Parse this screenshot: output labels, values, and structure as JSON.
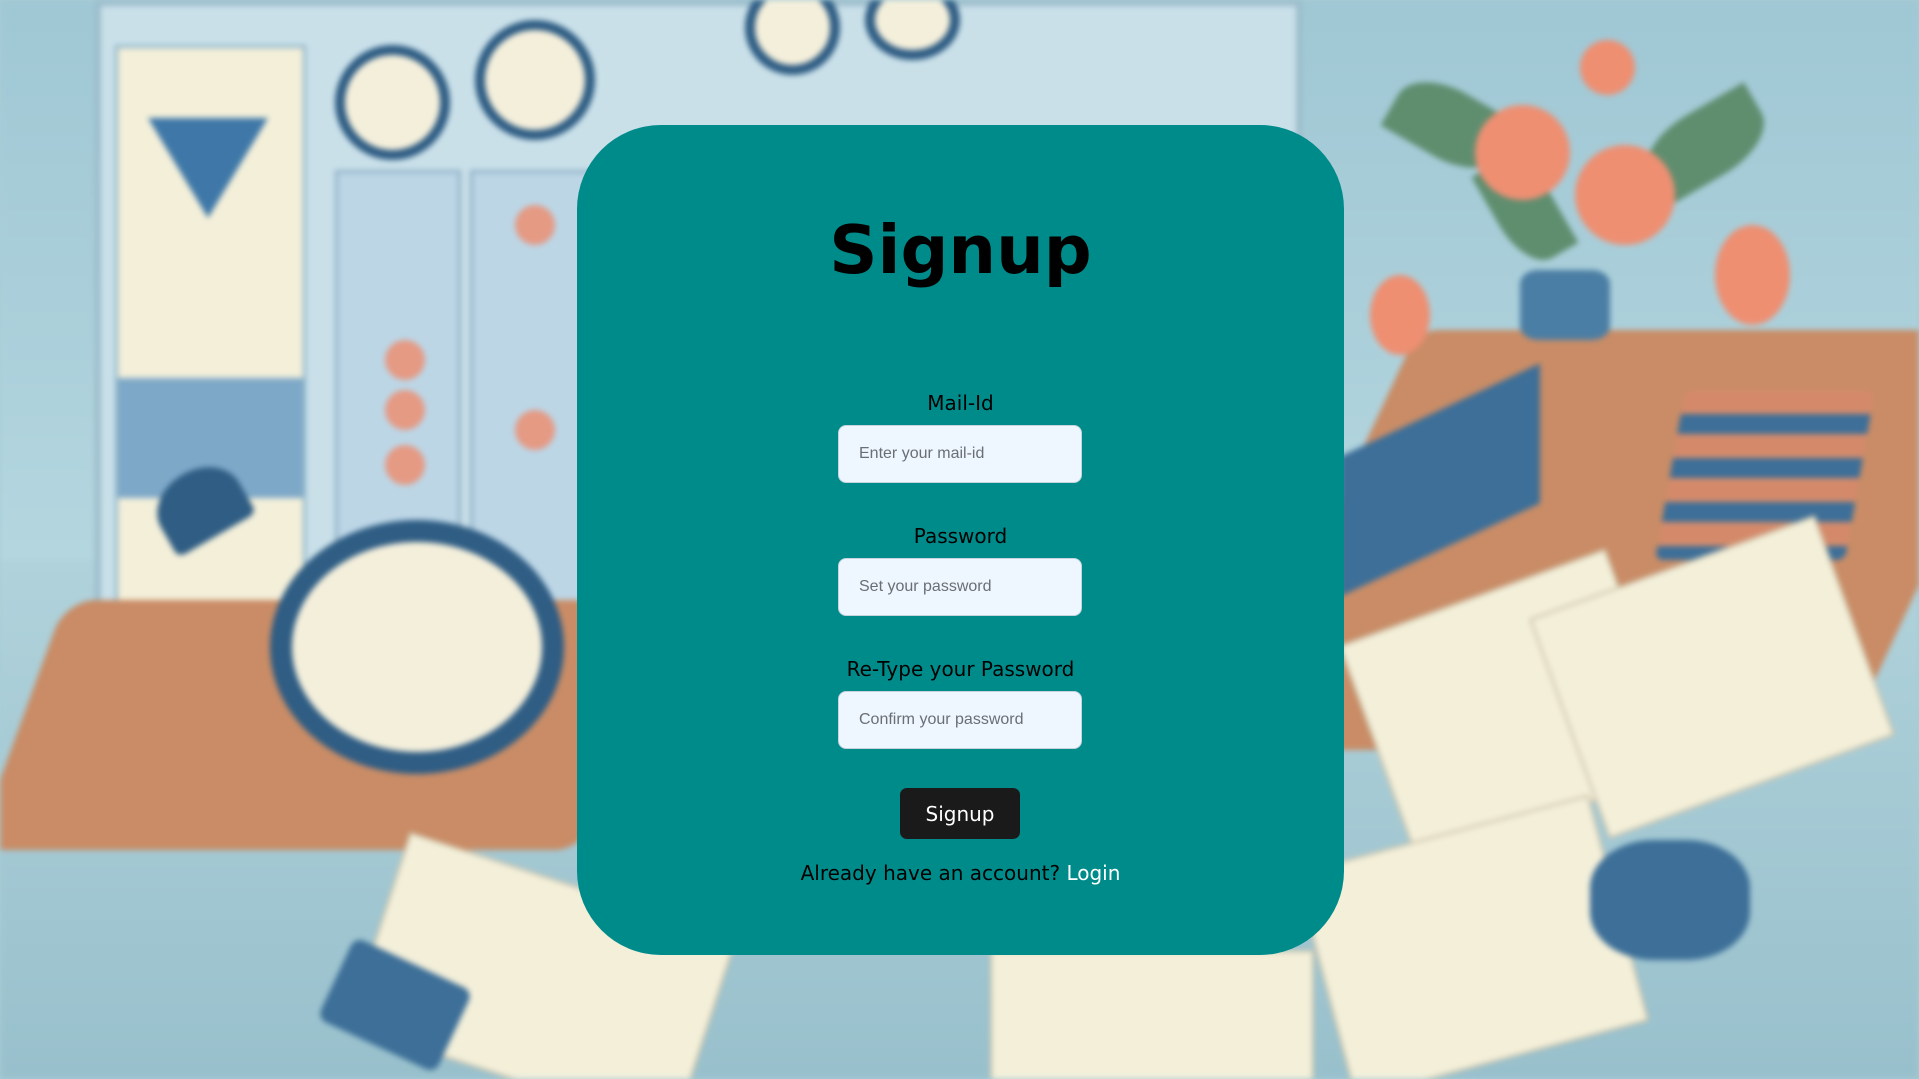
{
  "page": {
    "title": "Signup"
  },
  "form": {
    "email": {
      "label": "Mail-Id",
      "placeholder": "Enter your mail-id",
      "value": ""
    },
    "password": {
      "label": "Password",
      "placeholder": "Set your password",
      "value": ""
    },
    "confirm_password": {
      "label": "Re-Type your Password",
      "placeholder": "Confirm your password",
      "value": ""
    },
    "submit_label": "Signup"
  },
  "footer": {
    "prompt": "Already have an account?",
    "login_link": "Login"
  },
  "colors": {
    "card": "#008b8b",
    "button": "#1a1a1a",
    "input_bg": "#eef6ff",
    "link": "#ffffff"
  },
  "background": {
    "description_icon": "office-desk-illustration"
  }
}
